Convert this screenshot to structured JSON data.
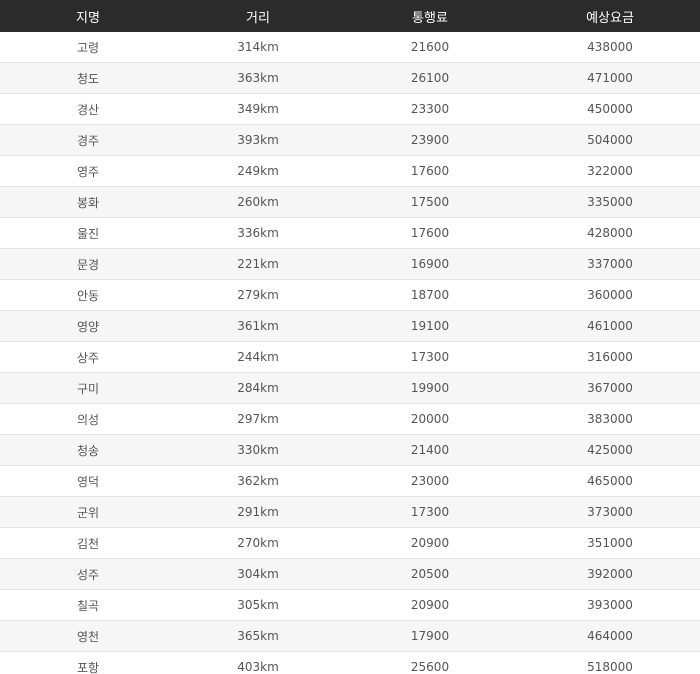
{
  "table": {
    "headers": [
      "지명",
      "거리",
      "통행료",
      "예상요금"
    ],
    "rows": [
      [
        "고령",
        "314km",
        "21600",
        "438000"
      ],
      [
        "청도",
        "363km",
        "26100",
        "471000"
      ],
      [
        "경산",
        "349km",
        "23300",
        "450000"
      ],
      [
        "경주",
        "393km",
        "23900",
        "504000"
      ],
      [
        "영주",
        "249km",
        "17600",
        "322000"
      ],
      [
        "봉화",
        "260km",
        "17500",
        "335000"
      ],
      [
        "울진",
        "336km",
        "17600",
        "428000"
      ],
      [
        "문경",
        "221km",
        "16900",
        "337000"
      ],
      [
        "안동",
        "279km",
        "18700",
        "360000"
      ],
      [
        "영양",
        "361km",
        "19100",
        "461000"
      ],
      [
        "상주",
        "244km",
        "17300",
        "316000"
      ],
      [
        "구미",
        "284km",
        "19900",
        "367000"
      ],
      [
        "의성",
        "297km",
        "20000",
        "383000"
      ],
      [
        "청송",
        "330km",
        "21400",
        "425000"
      ],
      [
        "영덕",
        "362km",
        "23000",
        "465000"
      ],
      [
        "군위",
        "291km",
        "17300",
        "373000"
      ],
      [
        "김천",
        "270km",
        "20900",
        "351000"
      ],
      [
        "성주",
        "304km",
        "20500",
        "392000"
      ],
      [
        "칠곡",
        "305km",
        "20900",
        "393000"
      ],
      [
        "영천",
        "365km",
        "17900",
        "464000"
      ],
      [
        "포항",
        "403km",
        "25600",
        "518000"
      ]
    ]
  }
}
